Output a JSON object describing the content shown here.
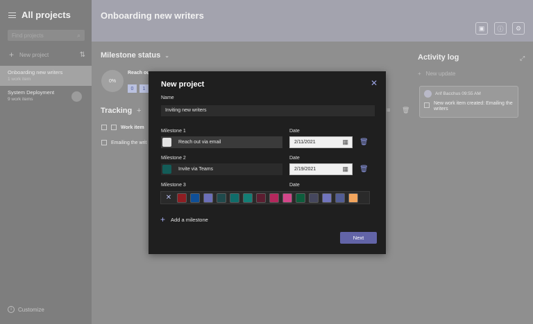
{
  "sidebar": {
    "title": "All projects",
    "search_placeholder": "Find projects",
    "new_project_label": "New project",
    "projects": [
      {
        "name": "Onboarding new writers",
        "sub": "1 work item"
      },
      {
        "name": "System Deployment",
        "sub": "9 work items"
      }
    ],
    "customize_label": "Customize"
  },
  "topbar": {
    "title": "Onboarding new writers"
  },
  "main": {
    "milestone_status_title": "Milestone status",
    "progress_percent": "0%",
    "milestone_name": "Reach ou",
    "chips": [
      "0",
      "1"
    ],
    "tracking_title": "Tracking",
    "work_item_header": "Work item",
    "work_item_row": "Emailing the writ"
  },
  "activity": {
    "title": "Activity log",
    "new_update_label": "New update",
    "card": {
      "author_time": "Arif Bacchus 09:55 AM",
      "message": "New work item created: Emailing the writers"
    }
  },
  "dialog": {
    "title": "New project",
    "name_label": "Name",
    "name_value": "Inviting new writers",
    "milestones": [
      {
        "label": "Milestone 1",
        "value": "Reach out via email",
        "date_label": "Date",
        "date": "2/11/2021",
        "color": "#e3e3e3"
      },
      {
        "label": "Milestone 2",
        "value": "Invite via Teams",
        "date_label": "Date",
        "date": "2/19/2021",
        "color": "#135c58"
      },
      {
        "label": "Milestone 3",
        "value": "",
        "date_label": "Date",
        "date": "",
        "color": ""
      }
    ],
    "palette_colors": [
      "#8e1d22",
      "#0f4f97",
      "#6b6fb8",
      "#1f4a4c",
      "#106c6a",
      "#137e75",
      "#5c1d30",
      "#b3275c",
      "#d3468a",
      "#0d5d3c",
      "#45475e",
      "#7175bd",
      "#525d95",
      "#f2a55d"
    ],
    "add_milestone_label": "Add a milestone",
    "next_label": "Next"
  },
  "colors": {
    "accent": "#6264a7",
    "dialog_bg": "#1f1f1f"
  }
}
